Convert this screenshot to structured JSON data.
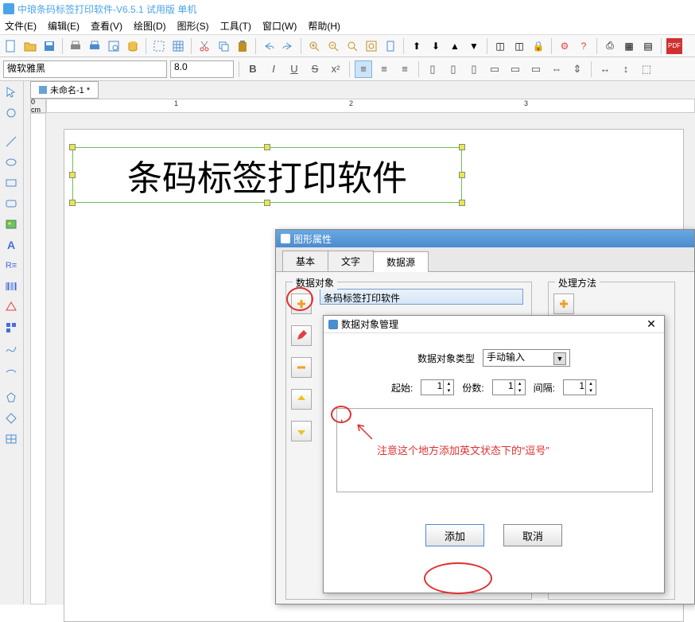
{
  "app": {
    "title": "中琅条码标签打印软件-V6.5.1 试用版 单机"
  },
  "menu": {
    "file": "文件(E)",
    "edit": "编辑(E)",
    "view": "查看(V)",
    "draw": "绘图(D)",
    "shape": "图形(S)",
    "tool": "工具(T)",
    "window": "窗口(W)",
    "help": "帮助(H)"
  },
  "format": {
    "font": "微软雅黑",
    "size": "8.0"
  },
  "doc": {
    "tab": "未命名-1 *",
    "ruler_unit": "0 cm",
    "tick1": "1",
    "tick2": "2",
    "tick3": "3"
  },
  "canvas": {
    "text": "条码标签打印软件"
  },
  "propsDialog": {
    "title": "图形属性",
    "tabs": {
      "basic": "基本",
      "text": "文字",
      "datasource": "数据源"
    },
    "dataObject": "数据对象",
    "process": "处理方法",
    "listItem": "条码标签打印软件"
  },
  "mgrDialog": {
    "title": "数据对象管理",
    "typeLabel": "数据对象类型",
    "typeValue": "手动输入",
    "startLabel": "起始:",
    "startVal": "1",
    "countLabel": "份数:",
    "countVal": "1",
    "gapLabel": "间隔:",
    "gapVal": "1",
    "textarea": ",",
    "addBtn": "添加",
    "cancelBtn": "取消"
  },
  "annotation": "注意这个地方添加英文状态下的“逗号”"
}
